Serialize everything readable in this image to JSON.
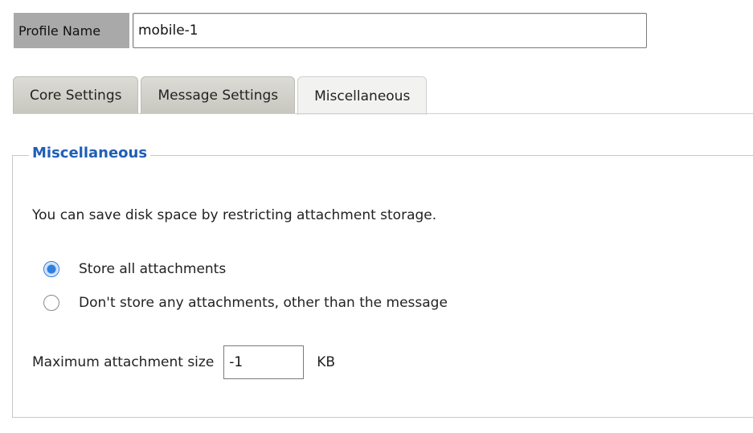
{
  "profile": {
    "label": "Profile Name",
    "value": "mobile-1"
  },
  "tabs": [
    {
      "label": "Core Settings",
      "active": false
    },
    {
      "label": "Message Settings",
      "active": false
    },
    {
      "label": "Miscellaneous",
      "active": true
    }
  ],
  "section": {
    "legend": "Miscellaneous",
    "description": "You can save disk space by restricting attachment storage.",
    "options": [
      {
        "label": "Store all attachments",
        "selected": true
      },
      {
        "label": "Don't store any attachments, other than the message",
        "selected": false
      }
    ],
    "max_size": {
      "label": "Maximum attachment size",
      "value": "-1",
      "unit": "KB"
    }
  },
  "colors": {
    "legend": "#1f5fb6",
    "profile_label_bg": "#a9a9a9",
    "radio_selected": "#2f7fe0"
  }
}
